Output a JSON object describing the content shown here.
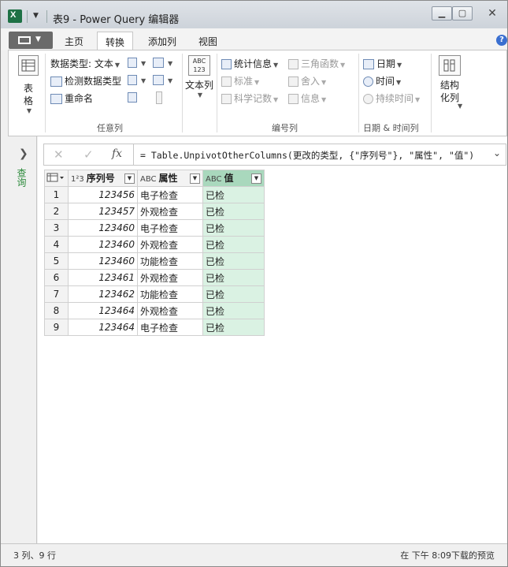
{
  "window": {
    "title": "表9 - Power Query 编辑器"
  },
  "ribbon_tabs": [
    {
      "label": "主页"
    },
    {
      "label": "转换"
    },
    {
      "label": "添加列"
    },
    {
      "label": "视图"
    }
  ],
  "active_tab": "转换",
  "ribbon": {
    "table_btn": "表格",
    "data_type": "数据类型: 文本",
    "detect_type": "检测数据类型",
    "rename": "重命名",
    "group_any_column": "任意列",
    "text_column_btn": "文本列",
    "statistics": "统计信息",
    "standard": "标准",
    "scientific": "科学记数",
    "trig": "三角函数",
    "rounding": "舍入",
    "information": "信息",
    "group_number_column": "编号列",
    "date": "日期",
    "time": "时间",
    "duration": "持续时间",
    "group_datetime": "日期 & 时间列",
    "structured_btn": "结构化列"
  },
  "queries_pane": {
    "label": "查询"
  },
  "formula_bar": {
    "cancel": "✕",
    "confirm": "✓",
    "fx": "fx",
    "formula": "= Table.UnpivotOtherColumns(更改的类型, {\"序列号\"}, \"属性\", \"值\")"
  },
  "grid": {
    "columns": [
      {
        "type": "1²3",
        "name": "序列号"
      },
      {
        "type": "ABC",
        "name": "属性"
      },
      {
        "type": "ABC",
        "name": "值"
      }
    ],
    "rows": [
      {
        "n": "1",
        "serial": "123456",
        "attr": "电子检查",
        "val": "已检"
      },
      {
        "n": "2",
        "serial": "123457",
        "attr": "外观检查",
        "val": "已检"
      },
      {
        "n": "3",
        "serial": "123460",
        "attr": "电子检查",
        "val": "已检"
      },
      {
        "n": "4",
        "serial": "123460",
        "attr": "外观检查",
        "val": "已检"
      },
      {
        "n": "5",
        "serial": "123460",
        "attr": "功能检查",
        "val": "已检"
      },
      {
        "n": "6",
        "serial": "123461",
        "attr": "外观检查",
        "val": "已检"
      },
      {
        "n": "7",
        "serial": "123462",
        "attr": "功能检查",
        "val": "已检"
      },
      {
        "n": "8",
        "serial": "123464",
        "attr": "外观检查",
        "val": "已检"
      },
      {
        "n": "9",
        "serial": "123464",
        "attr": "电子检查",
        "val": "已检"
      }
    ]
  },
  "status": {
    "left": "3 列、9 行",
    "right": "在 下午 8:09下载的预览"
  },
  "colors": {
    "selected_column_header": "#a9d8bd",
    "selected_column_cells": "#daf2e3",
    "queries_label": "#2e8b3d"
  }
}
